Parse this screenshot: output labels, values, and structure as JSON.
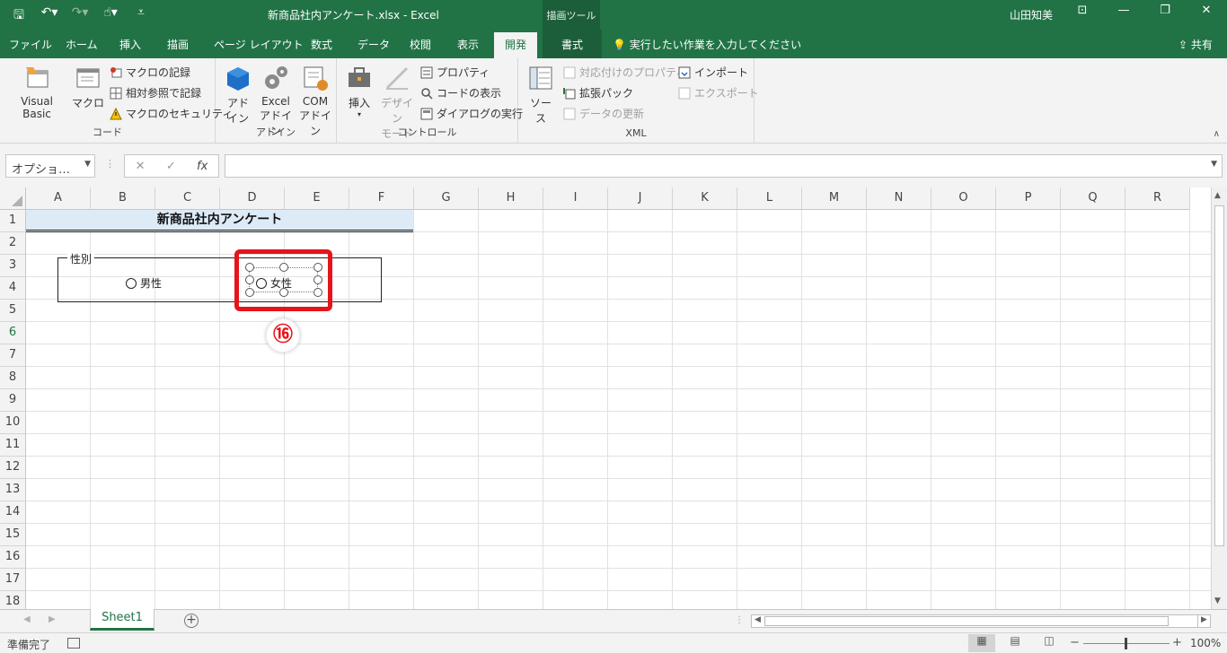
{
  "titlebar": {
    "doc_title": "新商品社内アンケート.xlsx  -  Excel",
    "context_tools": "描画ツール",
    "user": "山田知美"
  },
  "tabs": {
    "file": "ファイル",
    "home": "ホーム",
    "insert": "挿入",
    "draw": "描画",
    "page_layout": "ページ レイアウト",
    "formulas": "数式",
    "data": "データ",
    "review": "校閲",
    "view": "表示",
    "developer": "開発",
    "format": "書式",
    "tell_me": "実行したい作業を入力してください",
    "share": "共有"
  },
  "ribbon": {
    "code": {
      "label": "コード",
      "visual_basic": "Visual Basic",
      "macro": "マクロ",
      "record_macro": "マクロの記録",
      "relative_ref": "相対参照で記録",
      "macro_security": "マクロのセキュリティ"
    },
    "addins": {
      "label": "アドイン",
      "addin_line1": "アド",
      "addin_line2": "イン",
      "excel_addin_line1": "Excel",
      "excel_addin_line2": "アドイン",
      "com_addin_line1": "COM",
      "com_addin_line2": "アドイン"
    },
    "controls": {
      "label": "コントロール",
      "insert": "挿入",
      "design_mode_line1": "デザイン",
      "design_mode_line2": "モード",
      "properties": "プロパティ",
      "view_code": "コードの表示",
      "run_dialog": "ダイアログの実行"
    },
    "xml": {
      "label": "XML",
      "source": "ソース",
      "map_properties": "対応付けのプロパティ",
      "expansion_packs": "拡張パック",
      "refresh_data": "データの更新",
      "import": "インポート",
      "export": "エクスポート"
    }
  },
  "formula_bar": {
    "name_box": "オプショ…",
    "cancel": "✕",
    "enter": "✓",
    "fx": "fx",
    "content": ""
  },
  "columns": [
    "A",
    "B",
    "C",
    "D",
    "E",
    "F",
    "G",
    "H",
    "I",
    "J",
    "K",
    "L",
    "M",
    "N",
    "O",
    "P",
    "Q",
    "R"
  ],
  "rows": [
    "1",
    "2",
    "3",
    "4",
    "5",
    "6",
    "7",
    "8",
    "9",
    "10",
    "11",
    "12",
    "13",
    "14",
    "15",
    "16",
    "17",
    "18"
  ],
  "sheet": {
    "title": "新商品社内アンケート",
    "group_caption": "性別",
    "option_male": "男性",
    "option_female": "女性",
    "step_badge": "⑯"
  },
  "sheet_tabs": {
    "active": "Sheet1",
    "add": "+"
  },
  "status": {
    "ready": "準備完了",
    "zoom": "100%"
  },
  "colors": {
    "accent": "#217346",
    "highlight": "#e5141b",
    "title_fill": "#ddebf7"
  }
}
